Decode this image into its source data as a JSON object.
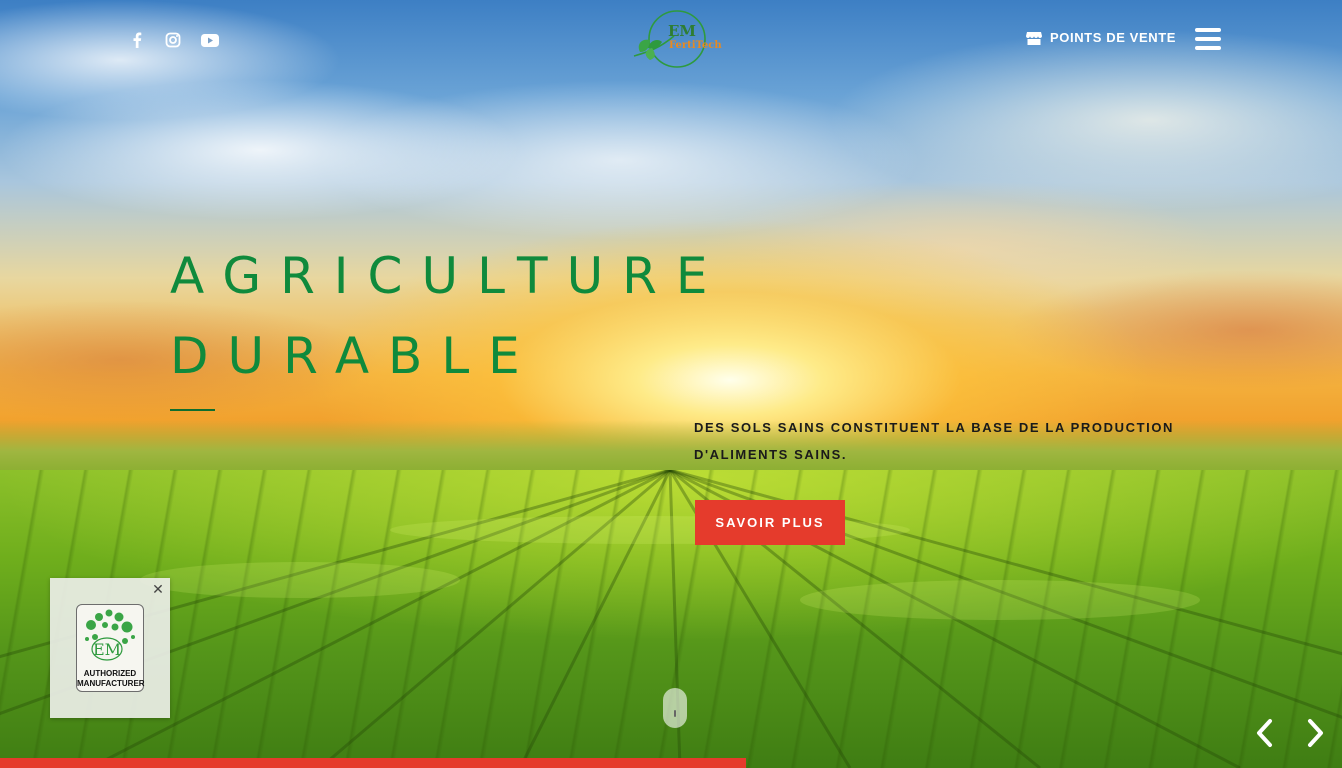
{
  "header": {
    "social": [
      {
        "name": "facebook-icon"
      },
      {
        "name": "instagram-icon"
      },
      {
        "name": "youtube-icon"
      }
    ],
    "logo": {
      "line1": "EM",
      "line2": "FertiTech"
    },
    "points_de_vente": "POINTS DE VENTE",
    "menu_icon": "hamburger-icon"
  },
  "hero": {
    "title_line1": "AGRICULTURE",
    "title_line2": "DURABLE",
    "tagline": "DES SOLS SAINS CONSTITUENT LA BASE DE LA PRODUCTION D'ALIMENTS SAINS.",
    "cta": "SAVOIR PLUS"
  },
  "badge": {
    "logo_text": "EM",
    "caption_line1": "AUTHORIZED",
    "caption_line2": "MANUFACTURER",
    "close_icon": "close-icon"
  },
  "slider": {
    "prev_icon": "chevron-left-icon",
    "next_icon": "chevron-right-icon",
    "progress": 0.556
  },
  "colors": {
    "title_green": "#0f8a3c",
    "cta_red": "#e53b2c",
    "logo_green": "#2e9a3e",
    "logo_orange": "#e98a1e"
  }
}
